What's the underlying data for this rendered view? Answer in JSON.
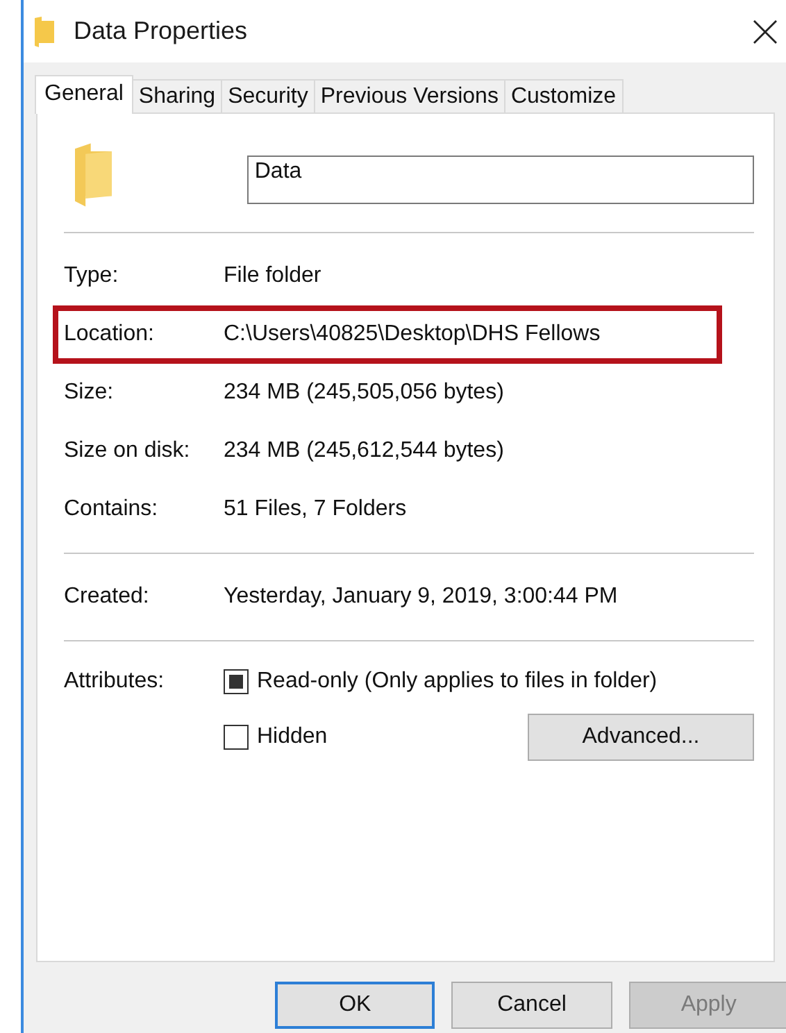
{
  "window": {
    "title": "Data Properties"
  },
  "tabs": [
    {
      "label": "General",
      "selected": true
    },
    {
      "label": "Sharing",
      "selected": false
    },
    {
      "label": "Security",
      "selected": false
    },
    {
      "label": "Previous Versions",
      "selected": false
    },
    {
      "label": "Customize",
      "selected": false
    }
  ],
  "name_field": {
    "value": "Data"
  },
  "groups": [
    {
      "rows": [
        {
          "label": "Type:",
          "value": "File folder",
          "highlighted": false
        },
        {
          "label": "Location:",
          "value": "C:\\Users\\40825\\Desktop\\DHS Fellows",
          "highlighted": true
        },
        {
          "label": "Size:",
          "value": "234 MB (245,505,056 bytes)",
          "highlighted": false
        },
        {
          "label": "Size on disk:",
          "value": "234 MB (245,612,544 bytes)",
          "highlighted": false
        },
        {
          "label": "Contains:",
          "value": "51 Files, 7 Folders",
          "highlighted": false
        }
      ]
    },
    {
      "rows": [
        {
          "label": "Created:",
          "value": "Yesterday, January 9, 2019, 3:00:44 PM",
          "highlighted": false
        }
      ]
    }
  ],
  "attributes": {
    "label": "Attributes:",
    "options": [
      {
        "label": "Read-only (Only applies to files in folder)",
        "indeterminate": true
      },
      {
        "label": "Hidden",
        "checked": false,
        "indeterminate": false
      }
    ],
    "advanced_button": "Advanced..."
  },
  "buttons": [
    {
      "label": "OK",
      "default": true,
      "disabled": false
    },
    {
      "label": "Cancel",
      "default": false,
      "disabled": false
    },
    {
      "label": "Apply",
      "default": false,
      "disabled": true
    }
  ]
}
